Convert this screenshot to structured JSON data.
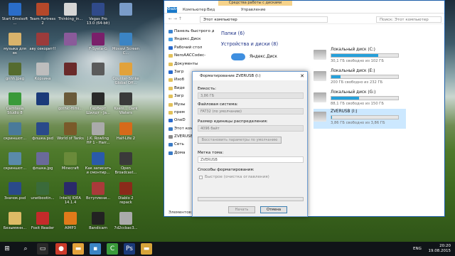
{
  "desktop": {
    "icons": [
      {
        "label": "Start Emsisoft ...",
        "color": "#2a6dc9"
      },
      {
        "label": "Team Fortress 2",
        "color": "#b5482a"
      },
      {
        "label": "Thinking_in...",
        "color": "#d6d6d6"
      },
      {
        "label": "Vegas Pro 13.0 (64-bit)",
        "color": "#304a8a"
      },
      {
        "label": "",
        "color": "#7a9cc9"
      },
      {
        "label": "музыка для вк",
        "color": "#d9b36b"
      },
      {
        "label": "аву секорит!!",
        "color": "#9b3b3b"
      },
      {
        "label": "",
        "color": "#8a5a9a"
      },
      {
        "label": "F-Syeta-G",
        "color": "#7a1f6a"
      },
      {
        "label": "Movavi Screen C...",
        "color": "#3b84c4"
      },
      {
        "label": "gnhh.jpeg",
        "color": "#556b2f"
      },
      {
        "label": "Корзина",
        "color": "#bdbdbd"
      },
      {
        "label": "",
        "color": "#6a2a2a"
      },
      {
        "label": "",
        "color": "#5b5b5b"
      },
      {
        "label": "Counter-Strike Global Off...",
        "color": "#e2a23b"
      },
      {
        "label": "Camtasia Studio 8",
        "color": "#3a9a3a"
      },
      {
        "label": "",
        "color": "#1b3a7a"
      },
      {
        "label": "gothic-filmi...",
        "color": "#6a5a3a"
      },
      {
        "label": "Герберт Шилдт - Ja...",
        "color": "#2a2a2a"
      },
      {
        "label": "Kseni... Dark Waters",
        "color": "#3a3a3a"
      },
      {
        "label": "скриншот...",
        "color": "#4a7a9a"
      },
      {
        "label": "флшка.psd",
        "color": "#2a4a8a"
      },
      {
        "label": "World of Tanks",
        "color": "#7a5a2a"
      },
      {
        "label": "J.K. Rowling HP 1 - Harr...",
        "color": "#aaaaaa"
      },
      {
        "label": "Half-Life 2",
        "color": "#d66a1a"
      },
      {
        "label": "скриншот...",
        "color": "#5a8aaa"
      },
      {
        "label": "флшка.jpg",
        "color": "#6a6a9a"
      },
      {
        "label": "Minecraft",
        "color": "#6a8a3a"
      },
      {
        "label": "Как записать и смонтир...",
        "color": "#2a5aaa"
      },
      {
        "label": "Open Broadcast...",
        "color": "#3a3a3a"
      },
      {
        "label": "Значок.psd",
        "color": "#2a4a8a"
      },
      {
        "label": "unetbootin...",
        "color": "#3a6a3a"
      },
      {
        "label": "IntelliJ IDEA 14.1.4",
        "color": "#2a2a6a"
      },
      {
        "label": "Вступлени...",
        "color": "#aa3a3a"
      },
      {
        "label": "Diablo 2 repack",
        "color": "#8a2a1a"
      },
      {
        "label": "Безымянн...",
        "color": "#ddbb66"
      },
      {
        "label": "Foxit Reader",
        "color": "#c42a2a"
      },
      {
        "label": "AIMP3",
        "color": "#e07a1a"
      },
      {
        "label": "Bandicam",
        "color": "#222222"
      },
      {
        "label": "7d2ccbac3...",
        "color": "#aaaaaa"
      }
    ]
  },
  "explorer": {
    "ribbon": {
      "file": "Файл",
      "tabs": [
        "Компьютер",
        "Вид"
      ],
      "context_title": "Средства работы с дисками",
      "context_tab": "Управление"
    },
    "path": "Этот компьютер",
    "search_placeholder": "Поиск: Этот компьютер",
    "sidebar": [
      {
        "label": "Панель быстрого до",
        "color": "#3b83d0"
      },
      {
        "label": "Яндекс.Диск",
        "color": "#4aa0e6"
      },
      {
        "label": "Рабочий стол",
        "color": "#2a6acc"
      },
      {
        "label": "NeroAACCodec-",
        "color": "#e2c15a"
      },
      {
        "label": "Документы",
        "color": "#e2c15a"
      },
      {
        "label": "Загр",
        "color": "#2a6acc"
      },
      {
        "label": "Изоб",
        "color": "#e2c15a"
      },
      {
        "label": "Виде",
        "color": "#e2c15a"
      },
      {
        "label": "Загр",
        "color": "#e2c15a"
      },
      {
        "label": "Музы",
        "color": "#e2c15a"
      },
      {
        "label": "прем",
        "color": "#e2c15a"
      },
      {
        "label": "OneD",
        "color": "#2a6acc"
      },
      {
        "label": "Этот комп",
        "color": "#3a7ac4"
      },
      {
        "label": "ZVERUSB",
        "color": "#888888"
      },
      {
        "label": "Сеть",
        "color": "#3a7ac4"
      },
      {
        "label": "Дома",
        "color": "#3a7ac4"
      }
    ],
    "folders_header": "Папки (6)",
    "devices_header": "Устройства и диски (8)",
    "yandex_label": "Яндекс.Диск",
    "drives": [
      {
        "name": "Локальный диск (C:)",
        "caption": "30,1 ГБ свободно из 102 ГБ",
        "used": 0.7,
        "color": "#26a0da",
        "selected": false
      },
      {
        "name": "Локальный диск (E:)",
        "caption": "200 ГБ свободно из 232 ГБ",
        "used": 0.14,
        "color": "#26a0da",
        "selected": false
      },
      {
        "name": "Локальный диск (G:)",
        "caption": "88,1 ГБ свободно из 150 ГБ",
        "used": 0.41,
        "color": "#26a0da",
        "selected": false
      },
      {
        "name": "ZVERUSB (I:)",
        "caption": "3,86 ГБ свободно из 3,86 ГБ",
        "used": 0.01,
        "color": "#26a0da",
        "selected": true
      }
    ],
    "status": "Элементов: 1"
  },
  "dialog": {
    "title": "Форматирование ZVERUSB (I:)",
    "capacity_label": "Емкость:",
    "capacity_value": "3,86 ГБ",
    "fs_label": "Файловая система:",
    "fs_value": "FAT32 (по умолчанию)",
    "alloc_label": "Размер единицы распределения:",
    "alloc_value": "4096 байт",
    "restore_button": "Восстановить параметры по умолчанию",
    "volume_label": "Метка тома:",
    "volume_value": "ZVERUSB",
    "format_options": "Способы форматирования:",
    "quick_format": "Быстрое (очистка оглавления)",
    "progress": 0,
    "start_button": "Начать",
    "close_button": "Отмена"
  },
  "taskbar": {
    "lang": "ENG",
    "time": "20:20",
    "date": "19.08.2015"
  }
}
